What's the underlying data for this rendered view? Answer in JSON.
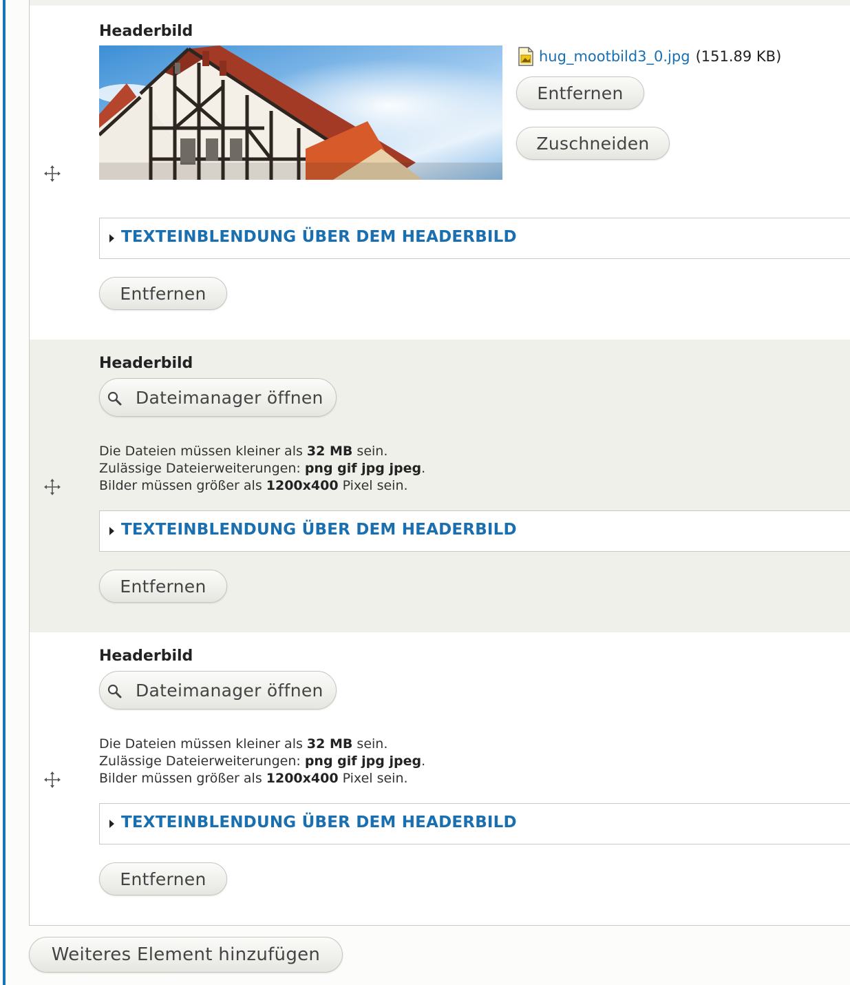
{
  "rows": [
    {
      "label": "Headerbild",
      "file": {
        "name": "hug_mootbild3_0.jpg",
        "size": "(151.89 KB)",
        "icon": "image-file-icon"
      },
      "remove_file_label": "Entfernen",
      "crop_label": "Zuschneiden",
      "details_summary": "TEXTEINBLENDUNG ÜBER DEM HEADERBILD",
      "remove_label": "Entfernen"
    },
    {
      "label": "Headerbild",
      "filemanager_label": "Dateimanager öffnen",
      "help": {
        "size_pre": "Die Dateien müssen kleiner als ",
        "size_val": "32 MB",
        "size_post": " sein.",
        "ext_pre": "Zulässige Dateierweiterungen: ",
        "ext_val": "png gif jpg jpeg",
        "ext_post": ".",
        "dim_pre": "Bilder müssen größer als ",
        "dim_val": "1200x400",
        "dim_post": " Pixel sein."
      },
      "details_summary": "TEXTEINBLENDUNG ÜBER DEM HEADERBILD",
      "remove_label": "Entfernen"
    },
    {
      "label": "Headerbild",
      "filemanager_label": "Dateimanager öffnen",
      "help": {
        "size_pre": "Die Dateien müssen kleiner als ",
        "size_val": "32 MB",
        "size_post": " sein.",
        "ext_pre": "Zulässige Dateierweiterungen: ",
        "ext_val": "png gif jpg jpeg",
        "ext_post": ".",
        "dim_pre": "Bilder müssen größer als ",
        "dim_val": "1200x400",
        "dim_post": " Pixel sein."
      },
      "details_summary": "TEXTEINBLENDUNG ÜBER DEM HEADERBILD",
      "remove_label": "Entfernen"
    }
  ],
  "add_more_label": "Weiteres Element hinzufügen",
  "colors": {
    "accent": "#1a6fb0",
    "left_bar": "#1a73b8",
    "alt_row": "#f0f0eb"
  }
}
